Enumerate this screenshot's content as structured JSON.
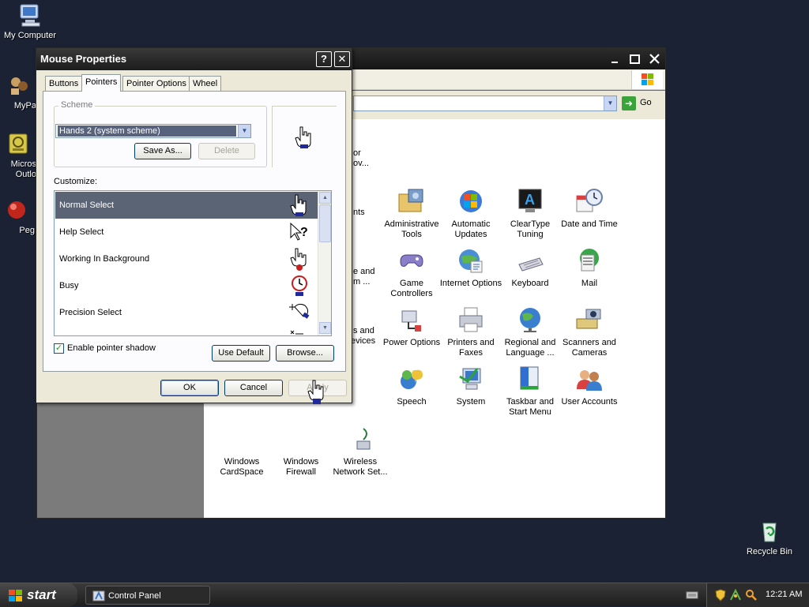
{
  "desktop": {
    "icons": [
      {
        "label": "My Computer"
      },
      {
        "label": "MyPa"
      },
      {
        "label": "Micros Outlo"
      },
      {
        "label": "Peg"
      },
      {
        "label": "Recycle Bin"
      }
    ]
  },
  "control_panel": {
    "title": "Control Panel",
    "go_label": "Go",
    "items": [
      {
        "label": "Administrative Tools",
        "icon": "admin-tools-icon"
      },
      {
        "label": "Automatic Updates",
        "icon": "automatic-updates-icon"
      },
      {
        "label": "ClearType Tuning",
        "icon": "cleartype-icon"
      },
      {
        "label": "Date and Time",
        "icon": "date-time-icon"
      },
      {
        "label": "Game Controllers",
        "icon": "game-controller-icon"
      },
      {
        "label": "Internet Options",
        "icon": "internet-options-icon"
      },
      {
        "label": "Keyboard",
        "icon": "keyboard-icon"
      },
      {
        "label": "Mail",
        "icon": "mail-icon"
      },
      {
        "label": "Power Options",
        "icon": "power-options-icon"
      },
      {
        "label": "Printers and Faxes",
        "icon": "printer-icon"
      },
      {
        "label": "Regional and Language ...",
        "icon": "globe-icon"
      },
      {
        "label": "Scanners and Cameras",
        "icon": "scanner-camera-icon"
      },
      {
        "label": "Speech",
        "icon": "speech-icon"
      },
      {
        "label": "System",
        "icon": "system-icon"
      },
      {
        "label": "Taskbar and Start Menu",
        "icon": "taskbar-icon"
      },
      {
        "label": "User Accounts",
        "icon": "user-accounts-icon"
      },
      {
        "label": "Windows CardSpace",
        "icon": "cardspace-icon"
      },
      {
        "label": "Windows Firewall",
        "icon": "firewall-icon"
      },
      {
        "label": "Wireless Network Set...",
        "icon": "wireless-icon"
      }
    ],
    "partial_labels": [
      "or",
      "ov...",
      "nts",
      "e and",
      "m ...",
      "s and",
      "evices"
    ]
  },
  "mouse_dialog": {
    "title": "Mouse Properties",
    "help_button": "?",
    "close_button": "✕",
    "tabs": [
      "Buttons",
      "Pointers",
      "Pointer Options",
      "Wheel"
    ],
    "active_tab": "Pointers",
    "scheme": {
      "group_label": "Scheme",
      "selected": "Hands 2 (system scheme)",
      "save_as": "Save As...",
      "delete": "Delete"
    },
    "customize_label": "Customize:",
    "cursors": [
      {
        "label": "Normal Select",
        "icon": "hand-pointer-icon",
        "selected": true
      },
      {
        "label": "Help Select",
        "icon": "help-pointer-icon",
        "selected": false
      },
      {
        "label": "Working In Background",
        "icon": "working-hand-icon",
        "selected": false
      },
      {
        "label": "Busy",
        "icon": "busy-clock-icon",
        "selected": false
      },
      {
        "label": "Precision Select",
        "icon": "precision-hand-icon",
        "selected": false
      }
    ],
    "enable_shadow_label": "Enable pointer shadow",
    "enable_shadow_checked": true,
    "use_default": "Use Default",
    "browse": "Browse...",
    "ok": "OK",
    "cancel": "Cancel",
    "apply": "Apply"
  },
  "taskbar": {
    "start_label": "start",
    "task_label": "Control Panel",
    "clock": "12:21 AM"
  }
}
